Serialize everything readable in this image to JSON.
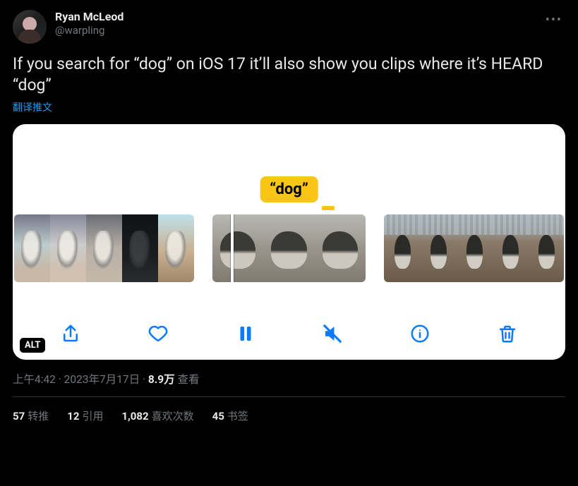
{
  "author": {
    "display_name": "Ryan McLeod",
    "handle": "@warpling"
  },
  "more_label": "•••",
  "body": "If you search for “dog” on iOS 17 it’ll also show you clips where it’s HEARD “dog”",
  "translate_label": "翻译推文",
  "media": {
    "bubble": "“dog”",
    "alt_badge": "ALT"
  },
  "meta": {
    "time": "上午4:42",
    "sep1": " · ",
    "date": "2023年7月17日",
    "sep2": " · ",
    "views_count": "8.9万",
    "views_label": " 查看"
  },
  "stats": {
    "retweets": {
      "count": "57",
      "label": "转推"
    },
    "quotes": {
      "count": "12",
      "label": "引用"
    },
    "likes": {
      "count": "1,082",
      "label": "喜欢次数"
    },
    "bookmarks": {
      "count": "45",
      "label": "书签"
    }
  }
}
